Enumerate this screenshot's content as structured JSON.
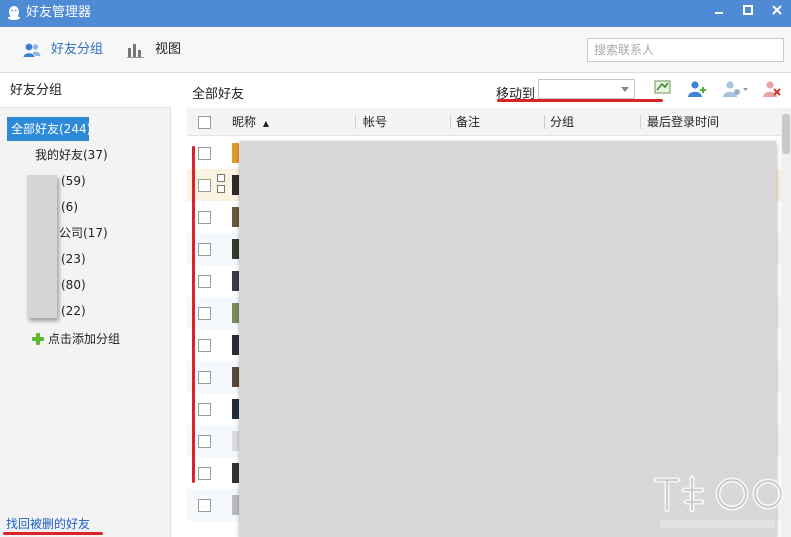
{
  "window": {
    "title": "好友管理器",
    "controls": [
      "minimize",
      "maximize",
      "close"
    ],
    "accent": "#4f8bd4"
  },
  "toolbar": {
    "tab_groups": "好友分组",
    "tab_view": "视图",
    "search_placeholder": "搜索联系人"
  },
  "sidebar": {
    "header": "好友分组",
    "groups": [
      {
        "label": "全部好友(244)",
        "active": true
      },
      {
        "label": "我的好友(37)"
      },
      {
        "label": "(59)"
      },
      {
        "label": "(6)"
      },
      {
        "label": "公司(17)"
      },
      {
        "label": "(23)"
      },
      {
        "label": "(80)"
      },
      {
        "label": "(22)"
      }
    ],
    "add_group": "点击添加分组",
    "find_deleted": "找回被删的好友"
  },
  "main": {
    "title": "全部好友",
    "move_to_label": "移动到",
    "move_to_value": "",
    "columns": [
      "昵称",
      "帐号",
      "备注",
      "分组",
      "最后登录时间"
    ],
    "sort_indicator": "▲"
  },
  "icons": [
    "qq-penguin-icon",
    "friends-group-icon",
    "chart-view-icon",
    "send-message-icon",
    "add-friend-icon",
    "settings-dropdown-icon",
    "delete-friend-icon",
    "plus-icon"
  ],
  "colors": {
    "selected_group": "#2d8ad8",
    "link": "#1c5ecd",
    "annotation": "#d9242b"
  }
}
